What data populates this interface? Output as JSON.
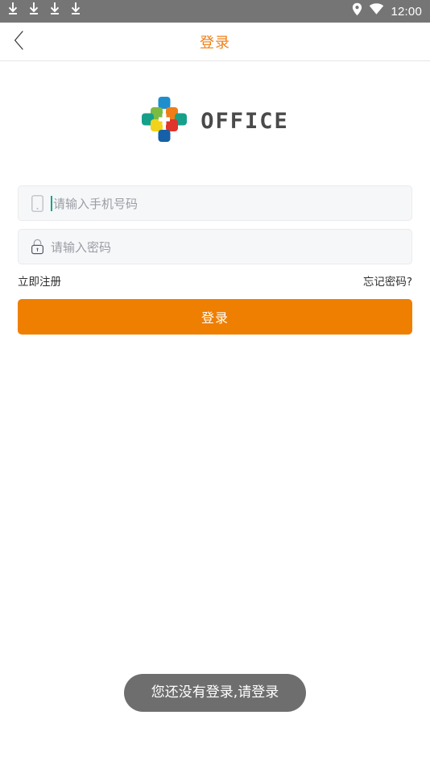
{
  "status_bar": {
    "background": "#757575",
    "download_icons": [
      {
        "name": "download-icon-1"
      },
      {
        "name": "download-icon-2"
      },
      {
        "name": "download-icon-3"
      },
      {
        "name": "download-icon-4"
      }
    ],
    "location_icon": "location-pin-icon",
    "wifi_icon": "wifi-icon",
    "time": "12:00"
  },
  "header": {
    "back_icon": "chevron-left-icon",
    "title": "登录",
    "title_color": "#ef8018"
  },
  "logo": {
    "mark_name": "office-cross-logo",
    "text": "OFFICE",
    "text_color": "#4a4a4a",
    "colors": {
      "blue": "#1f8ecd",
      "green": "#7cbb42",
      "orange": "#f07d18",
      "teal": "#16a08a",
      "yellow": "#f2d21a",
      "red": "#e0352b",
      "dark_blue": "#1560a8"
    }
  },
  "form": {
    "phone": {
      "icon": "phone-icon",
      "placeholder": "请输入手机号码",
      "value": "",
      "caret_color": "#14a38b",
      "focused": true
    },
    "password": {
      "icon": "lock-icon",
      "placeholder": "请输入密码",
      "value": "",
      "focused": false
    },
    "register_link": "立即注册",
    "forgot_link": "忘记密码?",
    "submit_label": "登录",
    "submit_color": "#ef7f00"
  },
  "toast": {
    "message": "您还没有登录,请登录",
    "background": "#6e6e6e"
  }
}
